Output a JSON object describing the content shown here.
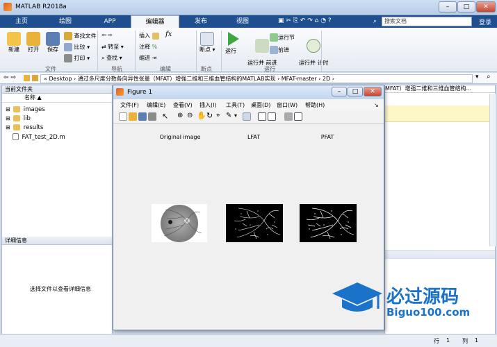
{
  "app_title": "MATLAB R2018a",
  "tabs": [
    "主页",
    "绘图",
    "APP",
    "编辑器",
    "发布",
    "视图"
  ],
  "search_placeholder": "搜索文档",
  "login_label": "登录",
  "ribbon": {
    "new": "新建",
    "open": "打开",
    "save": "保存",
    "find_files": "查找文件",
    "compare": "比较",
    "print": "打印",
    "goto": "转至",
    "find": "查找",
    "insert": "插入",
    "comment": "注释",
    "indent": "缩进",
    "fx": "fx",
    "breakpoints": "断点",
    "run": "运行",
    "run_advance": "运行并\n前进",
    "run_section": "运行节",
    "advance": "前进",
    "run_time": "运行并\n计时",
    "groups": [
      "文件",
      "导航",
      "编辑",
      "断点",
      "运行"
    ]
  },
  "address": {
    "path": "« Desktop › 通过多尺度分数各向异性张量（MFAT）增强二维和三维血管结构的MATLAB实现 › MFAT-master › 2D ›"
  },
  "current_folder": {
    "title": "当前文件夹",
    "column": "名称 ▲",
    "items": [
      "images",
      "lib",
      "results",
      "FAT_test_2D.m"
    ]
  },
  "details": {
    "title": "详细信息",
    "message": "选择文件以查看详细信息"
  },
  "right_header": "MFAT）增强二维和三维血管结构...",
  "status": {
    "row_label": "行",
    "row": "1",
    "col_label": "列",
    "col": "1"
  },
  "figure": {
    "title": "Figure 1",
    "menu": [
      "文件(F)",
      "编辑(E)",
      "查看(V)",
      "插入(I)",
      "工具(T)",
      "桌面(D)",
      "窗口(W)",
      "帮助(H)"
    ],
    "axes_titles": [
      "Original image",
      "LFAT",
      "PFAT"
    ]
  },
  "watermark": {
    "cn": "必过源码",
    "en": "Biguo100.com"
  },
  "colors": {
    "tabbar": "#1f4f8f",
    "accent": "#1a73c8"
  }
}
